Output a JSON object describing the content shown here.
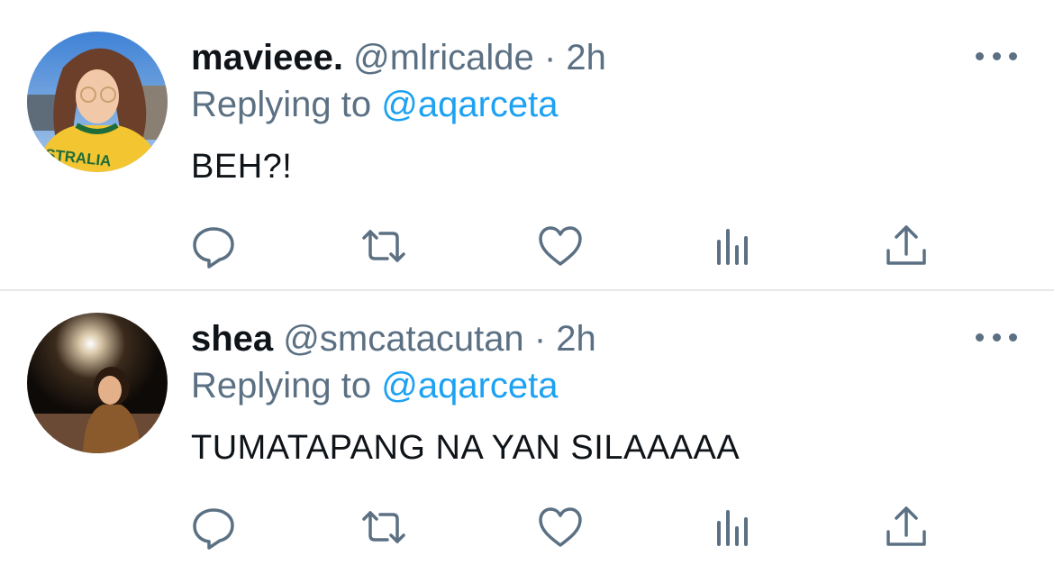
{
  "tweets": [
    {
      "display_name": "mavieee.",
      "handle": "@mlricalde",
      "separator": "·",
      "time": "2h",
      "replying_prefix": "Replying to",
      "replying_to": "@aqarceta",
      "text": "BEH?!",
      "avatar_shirt_text": "STRALIA"
    },
    {
      "display_name": "shea",
      "handle": "@smcatacutan",
      "separator": "·",
      "time": "2h",
      "replying_prefix": "Replying to",
      "replying_to": "@aqarceta",
      "text": "TUMATAPANG NA YAN SILAAAAA"
    }
  ],
  "icons": {
    "reply": "reply-icon",
    "retweet": "retweet-icon",
    "like": "heart-icon",
    "stats": "analytics-icon",
    "share": "share-icon",
    "more": "more-icon"
  },
  "colors": {
    "text_primary": "#0f1419",
    "text_secondary": "#5b7083",
    "link": "#1da1f2",
    "divider": "#e6e9ec"
  }
}
